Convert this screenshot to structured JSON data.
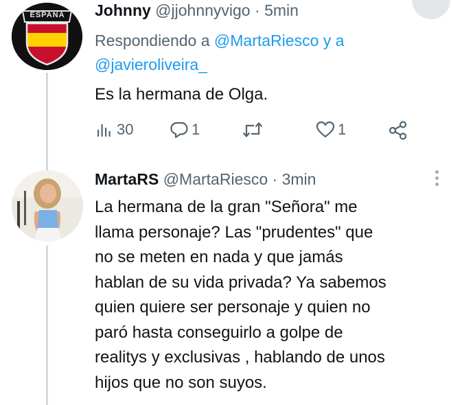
{
  "tweets": [
    {
      "name": "Johnny",
      "handle": "@jjohnnyvigo",
      "separator": "·",
      "time": "5min",
      "reply_prefix": "Respondiendo a",
      "reply_to_1": "@MartaRiesco",
      "reply_joiner": "y a",
      "reply_to_2": "@javieroliveira_",
      "text": "Es la hermana de Olga.",
      "avatar_badge_text": "ESPAÑA",
      "stats": {
        "views": "30",
        "replies": "1",
        "retweets": "",
        "likes": "1"
      }
    },
    {
      "name": "MartaRS",
      "handle": "@MartaRiesco",
      "separator": "·",
      "time": "3min",
      "text_lines": [
        "La hermana de la gran  \"Señora\" me",
        "llama personaje? Las \"prudentes\" que",
        "no se meten en nada y que jamás",
        "hablan de su vida privada? Ya sabemos",
        "quien quiere ser personaje y quien no",
        "paró hasta conseguirlo a golpe de",
        "realitys y exclusivas , hablando de unos",
        "hijos que no son suyos."
      ]
    }
  ],
  "icons": {
    "views": "bar-chart-icon",
    "reply": "speech-bubble-icon",
    "retweet": "retweet-icon",
    "like": "heart-icon",
    "share": "share-icon",
    "more": "more-vertical-icon"
  },
  "colors": {
    "link": "#1d9bf0",
    "muted": "#536471",
    "text": "#0f1419",
    "thread_line": "#cfd9de",
    "flag_red": "#c8102e",
    "flag_yellow": "#ffd200"
  }
}
